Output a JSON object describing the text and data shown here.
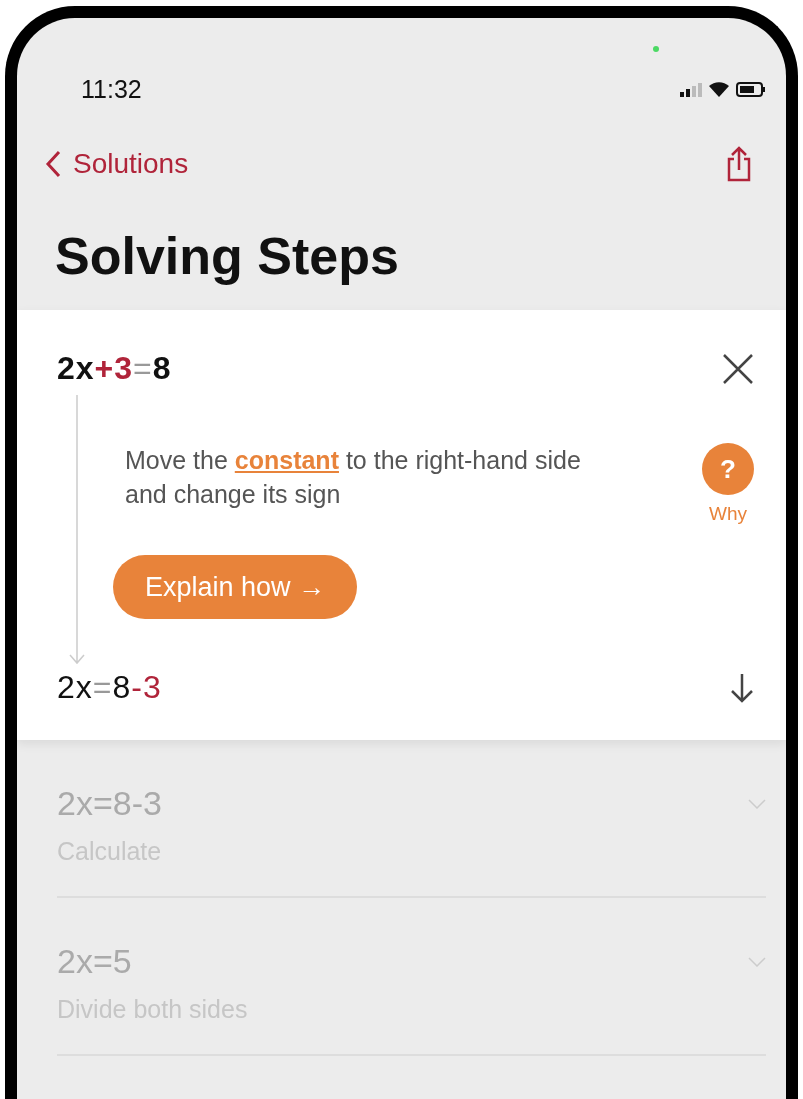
{
  "status_bar": {
    "time": "11:32"
  },
  "nav": {
    "back_label": "Solutions"
  },
  "title": "Solving Steps",
  "active_step": {
    "equation": [
      {
        "text": "2x",
        "kind": "term"
      },
      {
        "text": "+3",
        "kind": "changed"
      },
      {
        "text": "=",
        "kind": "equals"
      },
      {
        "text": "8",
        "kind": "term"
      }
    ],
    "explanation_before": "Move the ",
    "link": "constant",
    "explanation_after": " to the right-hand side and change its sign",
    "why_icon": "?",
    "why_label": "Why",
    "button": "Explain how →",
    "result": [
      {
        "text": "2x",
        "kind": "term"
      },
      {
        "text": "=",
        "kind": "equals"
      },
      {
        "text": "8",
        "kind": "term"
      },
      {
        "text": "-3",
        "kind": "changed"
      }
    ]
  },
  "collapsed_steps": [
    {
      "equation": "2x=8-3",
      "description": "Calculate"
    },
    {
      "equation": "2x=5",
      "description": "Divide both sides"
    }
  ]
}
